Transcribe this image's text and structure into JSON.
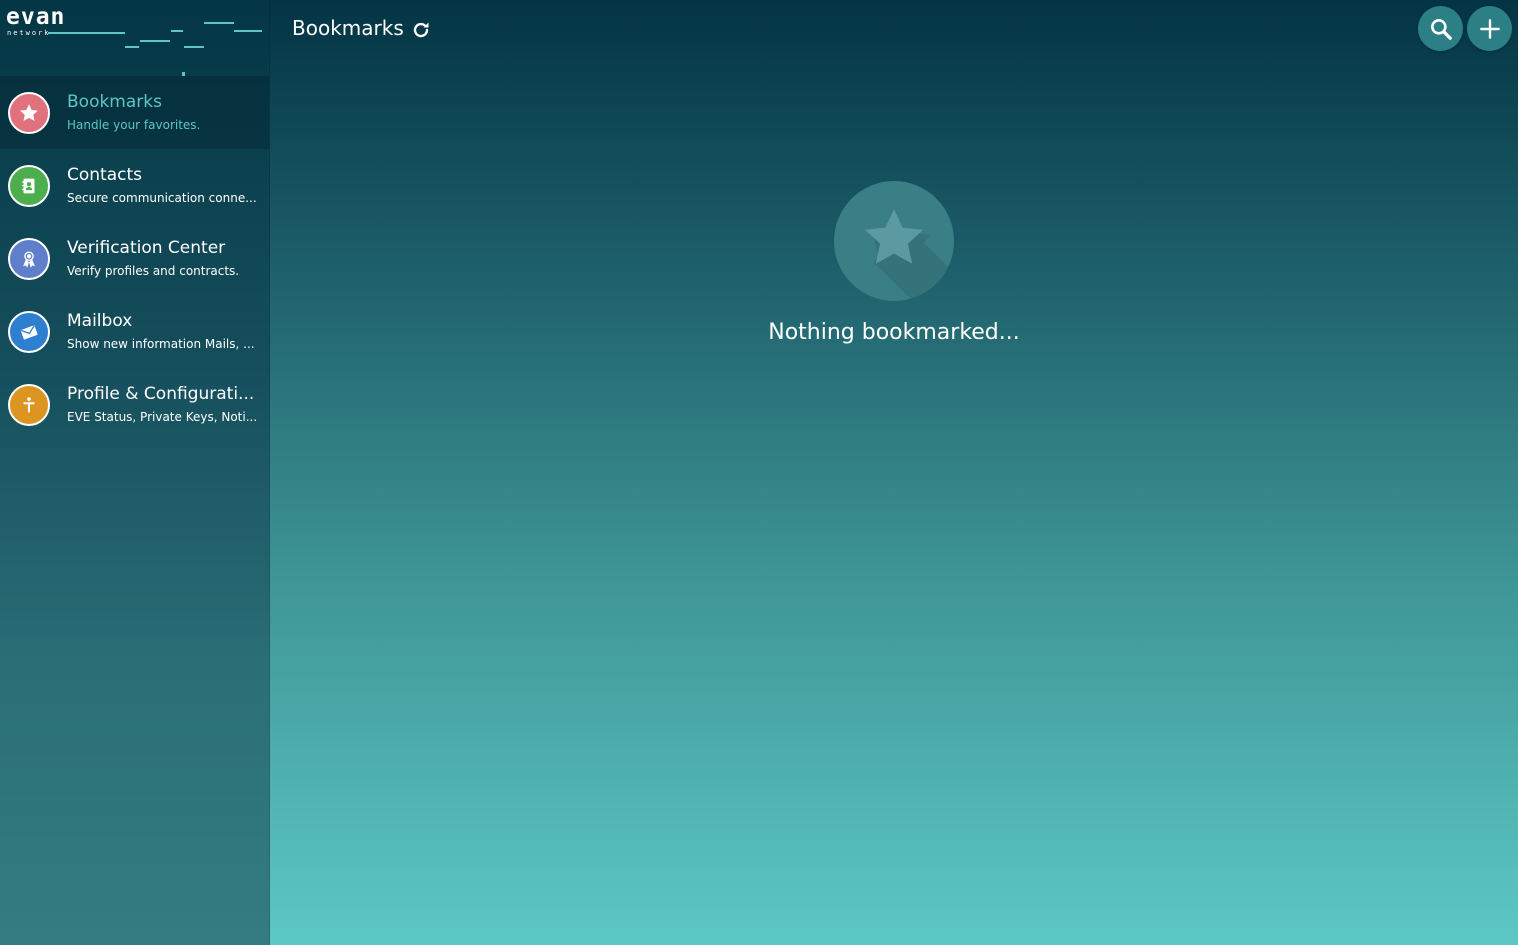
{
  "brand": {
    "logo_text": "evan",
    "logo_sub": "network"
  },
  "header": {
    "title": "Bookmarks"
  },
  "sidebar": {
    "items": [
      {
        "title": "Bookmarks",
        "subtitle": "Handle your favorites.",
        "icon": "star-icon",
        "color": "#e0727e",
        "active": true
      },
      {
        "title": "Contacts",
        "subtitle": "Secure communication conne...",
        "icon": "address-book-icon",
        "color": "#4cae4f",
        "active": false
      },
      {
        "title": "Verification Center",
        "subtitle": "Verify profiles and contracts.",
        "icon": "award-ribbon-icon",
        "color": "#5f7fcb",
        "active": false
      },
      {
        "title": "Mailbox",
        "subtitle": "Show new information Mails, ...",
        "icon": "envelope-icon",
        "color": "#2f7fd0",
        "active": false
      },
      {
        "title": "Profile & Configurati...",
        "subtitle": "EVE Status, Private Keys, Noti...",
        "icon": "profile-icon",
        "color": "#dc9520",
        "active": false
      }
    ]
  },
  "empty_state": {
    "message": "Nothing bookmarked..."
  },
  "colors": {
    "accent": "#5dc6c3",
    "button_bg": "#2c7f84"
  }
}
